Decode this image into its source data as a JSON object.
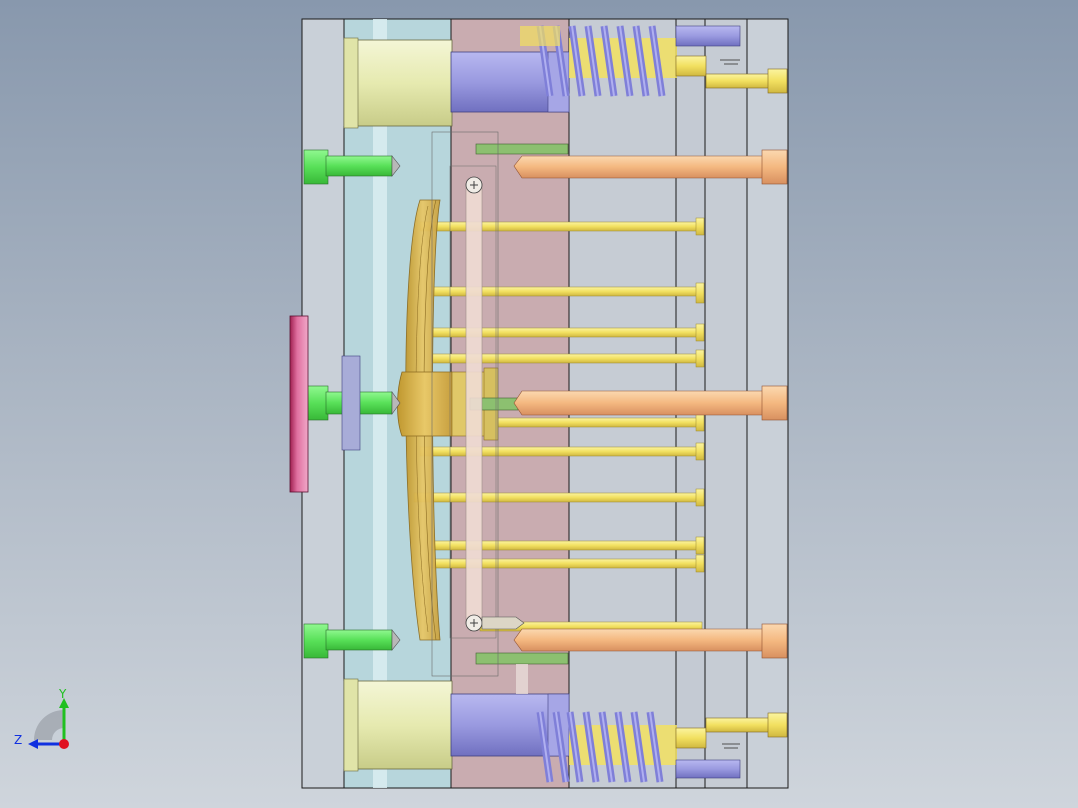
{
  "viewport": {
    "background_top": "#8898ad",
    "background_bottom": "#cfd5dc",
    "model": "injection-mold-assembly-side-view"
  },
  "triad": {
    "x_label": "",
    "y_label": "Y",
    "z_label": "Z",
    "x_color": "#e01020",
    "y_color": "#20c020",
    "z_color": "#1030e0"
  },
  "colors": {
    "plate_outline": "#1a1a1a",
    "clamp_plate": "#c9d0d8",
    "a_plate": "#b9d4dc",
    "b_plate": "#c8a8aa",
    "ejector_zone": "#c6ccd4",
    "guide_pillar": "#e8ecb8",
    "guide_bush": "#9090d8",
    "spring": "#8888e0",
    "ejector_pin": "#f0e060",
    "return_pin": "#f4b880",
    "sprue_screw": "#60e060",
    "locating_ring": "#e07090",
    "part": "#e0c060"
  }
}
